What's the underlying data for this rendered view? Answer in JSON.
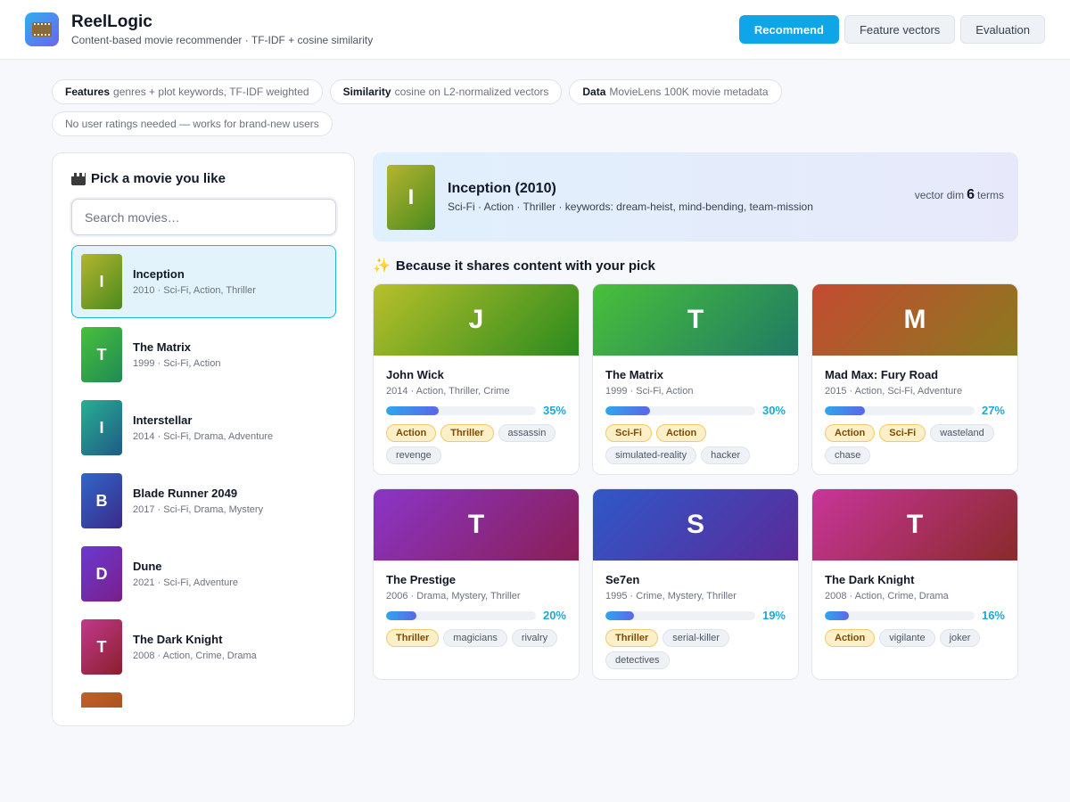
{
  "app": {
    "name": "ReelLogic",
    "subtitle": "Content-based movie recommender · TF-IDF + cosine similarity",
    "nav": [
      {
        "label": "Recommend",
        "active": true
      },
      {
        "label": "Feature vectors",
        "active": false
      },
      {
        "label": "Evaluation",
        "active": false
      }
    ]
  },
  "info_chips": [
    {
      "key": "Features",
      "text": "genres + plot keywords, TF-IDF weighted"
    },
    {
      "key": "Similarity",
      "text": "cosine on L2-normalized vectors"
    },
    {
      "key": "Data",
      "text": "MovieLens 100K movie metadata"
    },
    {
      "key": "",
      "text": "No user ratings needed — works for brand-new users"
    }
  ],
  "picker": {
    "title": "Pick a movie you like",
    "icon": "clapperboard-icon",
    "search_placeholder": "Search movies…",
    "movies": [
      {
        "initial": "I",
        "title": "Inception",
        "meta": "2010 · Sci-Fi, Action, Thriller",
        "selected": true,
        "colors": [
          "#b5b52f",
          "#4a8a1e"
        ]
      },
      {
        "initial": "T",
        "title": "The Matrix",
        "meta": "1999 · Sci-Fi, Action",
        "selected": false,
        "colors": [
          "#49c03a",
          "#1f8a55"
        ]
      },
      {
        "initial": "I",
        "title": "Interstellar",
        "meta": "2014 · Sci-Fi, Drama, Adventure",
        "selected": false,
        "colors": [
          "#27b092",
          "#1f5a85"
        ]
      },
      {
        "initial": "B",
        "title": "Blade Runner 2049",
        "meta": "2017 · Sci-Fi, Drama, Mystery",
        "selected": false,
        "colors": [
          "#3067c8",
          "#3a2a8a"
        ]
      },
      {
        "initial": "D",
        "title": "Dune",
        "meta": "2021 · Sci-Fi, Adventure",
        "selected": false,
        "colors": [
          "#6a3ad0",
          "#7a1e8a"
        ]
      },
      {
        "initial": "T",
        "title": "The Dark Knight",
        "meta": "2008 · Action, Crime, Drama",
        "selected": false,
        "colors": [
          "#c13a8e",
          "#8a1e2a"
        ]
      },
      {
        "initial": "",
        "title": "",
        "meta": "",
        "selected": false,
        "colors": [
          "#c2602a",
          "#9a4a1a"
        ]
      }
    ]
  },
  "selected": {
    "initial": "I",
    "title": "Inception (2010)",
    "meta": "Sci-Fi · Action · Thriller · keywords: dream-heist, mind-bending, team-mission",
    "dim_label": "vector dim",
    "dim_value": "6",
    "dim_unit": "terms",
    "colors": [
      "#b5b52f",
      "#4a8a1e"
    ]
  },
  "recommendations": {
    "title": "Because it shares content with your pick",
    "icon": "sparkles-icon",
    "items": [
      {
        "initial": "J",
        "title": "John Wick",
        "meta": "2014 · Action, Thriller, Crime",
        "score": 35,
        "score_label": "35%",
        "genre_tags": [
          "Action",
          "Thriller"
        ],
        "keyword_tags": [
          "assassin",
          "revenge"
        ],
        "colors": [
          "#b8c02a",
          "#2a8a1e"
        ]
      },
      {
        "initial": "T",
        "title": "The Matrix",
        "meta": "1999 · Sci-Fi, Action",
        "score": 30,
        "score_label": "30%",
        "genre_tags": [
          "Sci-Fi",
          "Action"
        ],
        "keyword_tags": [
          "simulated-reality",
          "hacker"
        ],
        "colors": [
          "#49c03a",
          "#1f7a65"
        ]
      },
      {
        "initial": "M",
        "title": "Mad Max: Fury Road",
        "meta": "2015 · Action, Sci-Fi, Adventure",
        "score": 27,
        "score_label": "27%",
        "genre_tags": [
          "Action",
          "Sci-Fi"
        ],
        "keyword_tags": [
          "wasteland",
          "chase"
        ],
        "colors": [
          "#c44a32",
          "#8a7a1e"
        ]
      },
      {
        "initial": "T",
        "title": "The Prestige",
        "meta": "2006 · Drama, Mystery, Thriller",
        "score": 20,
        "score_label": "20%",
        "genre_tags": [
          "Thriller"
        ],
        "keyword_tags": [
          "magicians",
          "rivalry"
        ],
        "colors": [
          "#8a35c8",
          "#8a1e55"
        ]
      },
      {
        "initial": "S",
        "title": "Se7en",
        "meta": "1995 · Crime, Mystery, Thriller",
        "score": 19,
        "score_label": "19%",
        "genre_tags": [
          "Thriller"
        ],
        "keyword_tags": [
          "serial-killer",
          "detectives"
        ],
        "colors": [
          "#3058c8",
          "#5a2a9a"
        ]
      },
      {
        "initial": "T",
        "title": "The Dark Knight",
        "meta": "2008 · Action, Crime, Drama",
        "score": 16,
        "score_label": "16%",
        "genre_tags": [
          "Action"
        ],
        "keyword_tags": [
          "vigilante",
          "joker"
        ],
        "colors": [
          "#c8359a",
          "#8a2a2a"
        ]
      }
    ]
  }
}
